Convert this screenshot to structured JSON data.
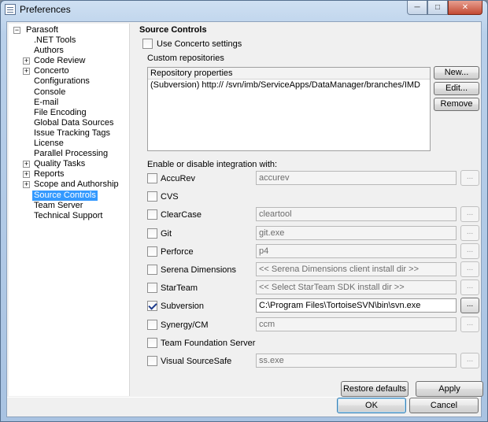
{
  "window": {
    "title": "Preferences",
    "buttons": {
      "minimize": "─",
      "maximize": "□",
      "close": "✕"
    }
  },
  "tree": {
    "root": "Parasoft",
    "items": [
      {
        "label": ".NET Tools",
        "expandable": false
      },
      {
        "label": "Authors",
        "expandable": false
      },
      {
        "label": "Code Review",
        "expandable": true
      },
      {
        "label": "Concerto",
        "expandable": true
      },
      {
        "label": "Configurations",
        "expandable": false
      },
      {
        "label": "Console",
        "expandable": false
      },
      {
        "label": "E-mail",
        "expandable": false
      },
      {
        "label": "File Encoding",
        "expandable": false
      },
      {
        "label": "Global Data Sources",
        "expandable": false
      },
      {
        "label": "Issue Tracking Tags",
        "expandable": false
      },
      {
        "label": "License",
        "expandable": false
      },
      {
        "label": "Parallel Processing",
        "expandable": false
      },
      {
        "label": "Quality Tasks",
        "expandable": true
      },
      {
        "label": "Reports",
        "expandable": true
      },
      {
        "label": "Scope and Authorship",
        "expandable": true
      },
      {
        "label": "Source Controls",
        "expandable": false,
        "selected": true
      },
      {
        "label": "Team Server",
        "expandable": false
      },
      {
        "label": "Technical Support",
        "expandable": false
      }
    ]
  },
  "panel": {
    "title": "Source Controls",
    "use_concerto": {
      "label": "Use Concerto settings",
      "checked": false
    },
    "custom_repos": {
      "label": "Custom repositories",
      "column": "Repository properties",
      "rows": [
        "(Subversion) http://                    /svn/imb/ServiceApps/DataManager/branches/IMD"
      ]
    },
    "repo_buttons": {
      "new": "New...",
      "edit": "Edit...",
      "remove": "Remove"
    },
    "integration_label": "Enable or disable integration with:",
    "integrations": [
      {
        "label": "AccuRev",
        "checked": false,
        "value": "accurev",
        "has_field": true
      },
      {
        "label": "CVS",
        "checked": false,
        "value": "",
        "has_field": false
      },
      {
        "label": "ClearCase",
        "checked": false,
        "value": "cleartool",
        "has_field": true
      },
      {
        "label": "Git",
        "checked": false,
        "value": "git.exe",
        "has_field": true
      },
      {
        "label": "Perforce",
        "checked": false,
        "value": "p4",
        "has_field": true
      },
      {
        "label": "Serena Dimensions",
        "checked": false,
        "value": "<< Serena Dimensions client install dir >>",
        "has_field": true
      },
      {
        "label": "StarTeam",
        "checked": false,
        "value": "<< Select StarTeam SDK install dir >>",
        "has_field": true
      },
      {
        "label": "Subversion",
        "checked": true,
        "value": "C:\\Program Files\\TortoiseSVN\\bin\\svn.exe",
        "has_field": true
      },
      {
        "label": "Synergy/CM",
        "checked": false,
        "value": "ccm",
        "has_field": true
      },
      {
        "label": "Team Foundation Server",
        "checked": false,
        "value": "",
        "has_field": false
      },
      {
        "label": "Visual SourceSafe",
        "checked": false,
        "value": "ss.exe",
        "has_field": true
      }
    ],
    "browse_label": "...",
    "restore_defaults": "Restore defaults",
    "apply": "Apply"
  },
  "footer": {
    "ok": "OK",
    "cancel": "Cancel"
  }
}
